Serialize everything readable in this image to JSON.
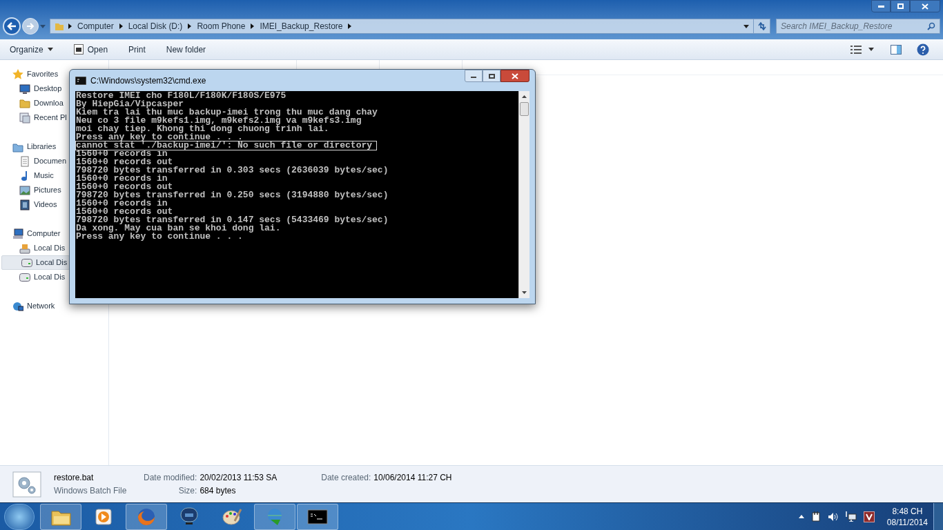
{
  "explorer": {
    "breadcrumb": [
      "Computer",
      "Local Disk (D:)",
      "Room Phone",
      "IMEI_Backup_Restore"
    ],
    "search": {
      "placeholder": "Search IMEI_Backup_Restore"
    },
    "toolbar": [
      {
        "label": "Organize",
        "kind": "menu"
      },
      {
        "label": "Open",
        "kind": "icon"
      },
      {
        "label": "Print",
        "kind": "plain"
      },
      {
        "label": "New folder",
        "kind": "plain"
      }
    ],
    "nav": [
      {
        "label": "Favorites",
        "selected": false,
        "children": [
          {
            "label": "Desktop",
            "selected": false
          },
          {
            "label": "Downloa",
            "selected": false
          },
          {
            "label": "Recent Pl",
            "selected": false
          }
        ]
      },
      {
        "label": "Libraries",
        "selected": false,
        "children": [
          {
            "label": "Documen",
            "selected": false
          },
          {
            "label": "Music",
            "selected": false
          },
          {
            "label": "Pictures",
            "selected": false
          },
          {
            "label": "Videos",
            "selected": false
          }
        ]
      },
      {
        "label": "Computer",
        "selected": false,
        "children": [
          {
            "label": "Local Dis",
            "selected": false
          },
          {
            "label": "Local Dis",
            "selected": true
          },
          {
            "label": "Local Dis",
            "selected": false
          }
        ]
      },
      {
        "label": "Network",
        "selected": false
      }
    ],
    "details": {
      "name": "restore.bat",
      "type": "Windows Batch File",
      "fields": [
        {
          "label": "Date modified:",
          "value": "20/02/2013 11:53 SA"
        },
        {
          "label": "Size:",
          "value": "684 bytes"
        },
        {
          "label": "Date created:",
          "value": "10/06/2014 11:27 CH"
        }
      ]
    }
  },
  "console": {
    "title": "C:\\Windows\\system32\\cmd.exe",
    "lines": [
      {
        "text": "Restore IMEI cho F180L/F180K/F180S/E975",
        "selected": false
      },
      {
        "text": "By HiepGia/Vipcasper",
        "selected": false
      },
      {
        "text": "Kiem tra lai thu muc backup-imei trong thu muc dang chay",
        "selected": false
      },
      {
        "text": "Neu co 3 file m9kefs1.img, m9kefs2.img va m9kefs3.img",
        "selected": false
      },
      {
        "text": "moi chay tiep. Khong thi dong chuong trinh lai.",
        "selected": false
      },
      {
        "text": "Press any key to continue . . .",
        "selected": false
      },
      {
        "text": "cannot stat './backup-imei/': No such file or directory",
        "selected": true
      },
      {
        "text": "1560+0 records in",
        "selected": false
      },
      {
        "text": "1560+0 records out",
        "selected": false
      },
      {
        "text": "798720 bytes transferred in 0.303 secs (2636039 bytes/sec)",
        "selected": false
      },
      {
        "text": "1560+0 records in",
        "selected": false
      },
      {
        "text": "1560+0 records out",
        "selected": false
      },
      {
        "text": "798720 bytes transferred in 0.250 secs (3194880 bytes/sec)",
        "selected": false
      },
      {
        "text": "1560+0 records in",
        "selected": false
      },
      {
        "text": "1560+0 records out",
        "selected": false
      },
      {
        "text": "798720 bytes transferred in 0.147 secs (5433469 bytes/sec)",
        "selected": false
      },
      {
        "text": "Da xong. May cua ban se khoi dong lai.",
        "selected": false
      },
      {
        "text": "Press any key to continue . . .",
        "selected": false
      }
    ]
  },
  "taskbar": {
    "apps": [
      {
        "running": true
      },
      {
        "running": false
      },
      {
        "running": true
      },
      {
        "running": false
      },
      {
        "running": false
      },
      {
        "running": true
      },
      {
        "running": true
      }
    ],
    "time": "8:48 CH",
    "date": "08/11/2014"
  }
}
